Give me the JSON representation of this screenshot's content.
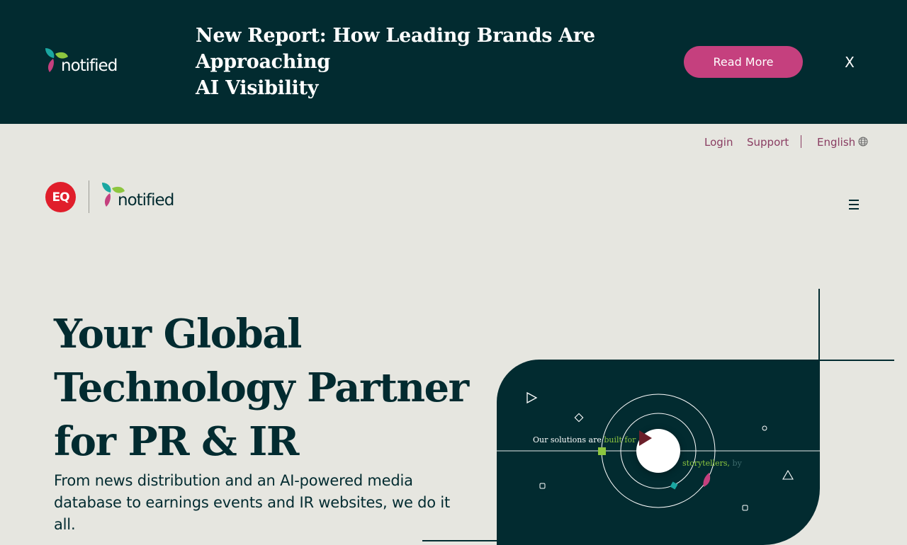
{
  "banner": {
    "brand": "notified",
    "title_lines": [
      "New Report: How Leading Brands Are",
      "Approaching",
      "AI Visibility"
    ],
    "cta_label": "Read More",
    "close_label": "X",
    "background_color": "#022b30",
    "cta_color": "#c5407e"
  },
  "utility_nav": {
    "login": "Login",
    "support": "Support",
    "language": "English",
    "language_icon": "globe-icon"
  },
  "header": {
    "eq_logo_text": "EQ",
    "brand": "notified",
    "menu_icon": "hamburger-menu-icon"
  },
  "hero": {
    "title_lines": [
      "Your Global",
      "Technology Partner",
      "for PR & IR"
    ],
    "subtitle": "From news distribution and an AI-powered media database to earnings events and IR websites, we do it all."
  },
  "video": {
    "caption_start": "Our solutions are ",
    "caption_highlight": "built for",
    "caption_second": "storytellers, ",
    "caption_second_dim": "by",
    "play_icon": "play-icon"
  }
}
